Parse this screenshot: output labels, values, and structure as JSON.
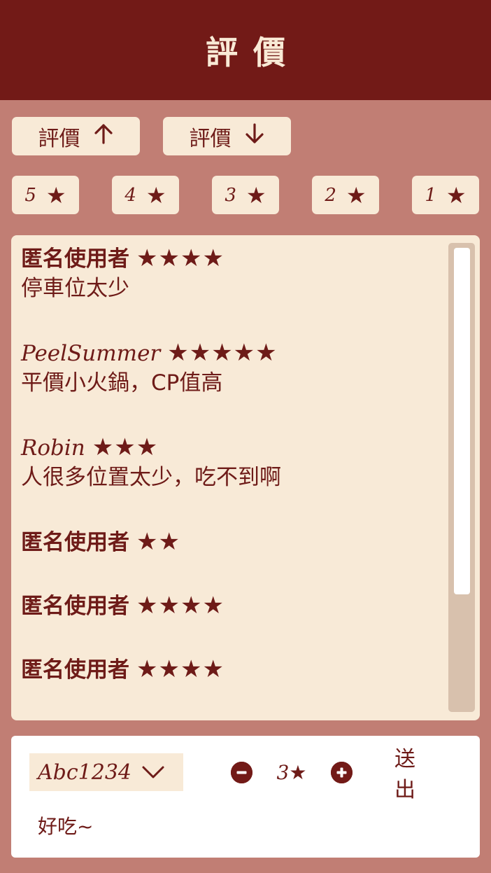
{
  "header": {
    "title": "評價"
  },
  "sort": [
    {
      "label": "評價",
      "direction": "up"
    },
    {
      "label": "評價",
      "direction": "down"
    }
  ],
  "star_filters": [
    {
      "label": "5",
      "star": "★"
    },
    {
      "label": "4",
      "star": "★"
    },
    {
      "label": "3",
      "star": "★"
    },
    {
      "label": "2",
      "star": "★"
    },
    {
      "label": "1",
      "star": "★"
    }
  ],
  "reviews": [
    {
      "name": "匿名使用者",
      "stars": "★★★★",
      "text": "停車位太少"
    },
    {
      "name": "PeelSummer",
      "stars": "★★★★★",
      "text": "平價小火鍋，CP值高"
    },
    {
      "name": "Robin",
      "stars": "★★★",
      "text": "人很多位置太少，吃不到啊"
    },
    {
      "name": "匿名使用者",
      "stars": "★★",
      "text": ""
    },
    {
      "name": "匿名使用者",
      "stars": "★★★★",
      "text": ""
    },
    {
      "name": "匿名使用者",
      "stars": "★★★★",
      "text": ""
    }
  ],
  "compose": {
    "user_value": "Abc1234",
    "rating_value": "3",
    "rating_star": "★",
    "send_label": "送出",
    "comment": "好吃~"
  },
  "colors": {
    "header_bg": "#721a17",
    "page_bg": "#c17e74",
    "card_bg": "#f8ead7",
    "text": "#6e1b18"
  }
}
